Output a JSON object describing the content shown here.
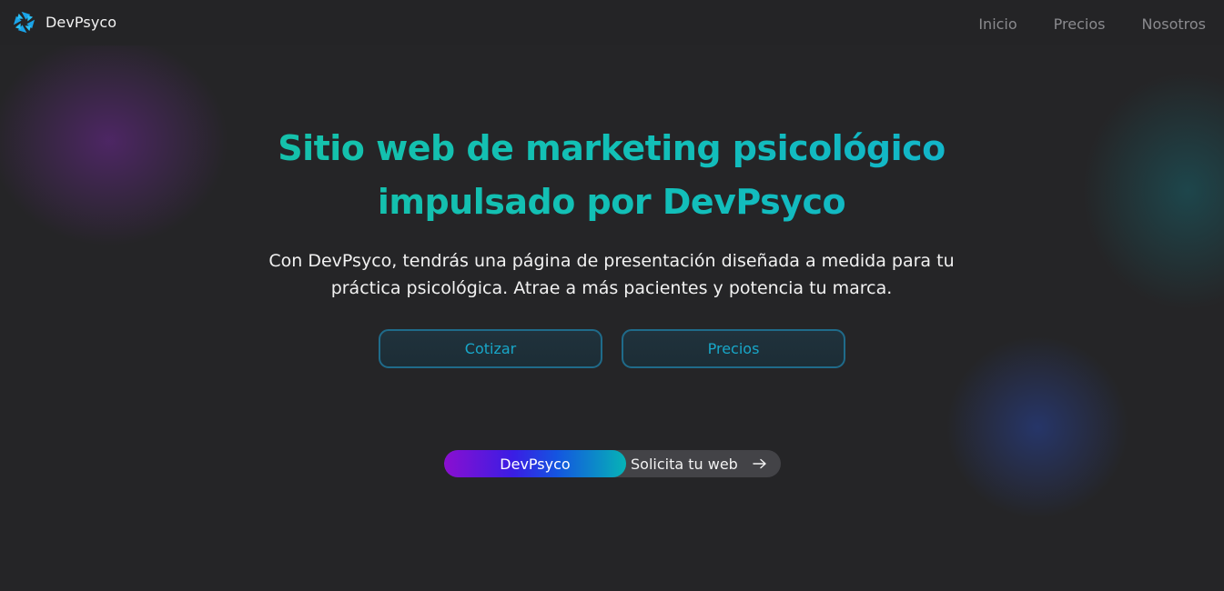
{
  "header": {
    "brand_name": "DevPsyco",
    "nav": [
      {
        "label": "Inicio"
      },
      {
        "label": "Precios"
      },
      {
        "label": "Nosotros"
      }
    ]
  },
  "hero": {
    "title_line1": "Sitio web de marketing psicológico",
    "title_line2": "impulsado por DevPsyco",
    "subtitle_line1": "Con DevPsyco, tendrás una página de presentación diseñada a medida para tu",
    "subtitle_line2": "práctica psicológica. Atrae a más pacientes y potencia tu marca.",
    "buttons": {
      "cotizar": "Cotizar",
      "precios": "Precios"
    }
  },
  "pill": {
    "badge": "DevPsyco",
    "text": "Solicita tu web",
    "icon": "arrow-right-icon"
  },
  "colors": {
    "background": "#252527",
    "accent_teal": "#16c2a6",
    "accent_cyan": "#18a7c9",
    "nav_text": "#8a8a8e"
  }
}
